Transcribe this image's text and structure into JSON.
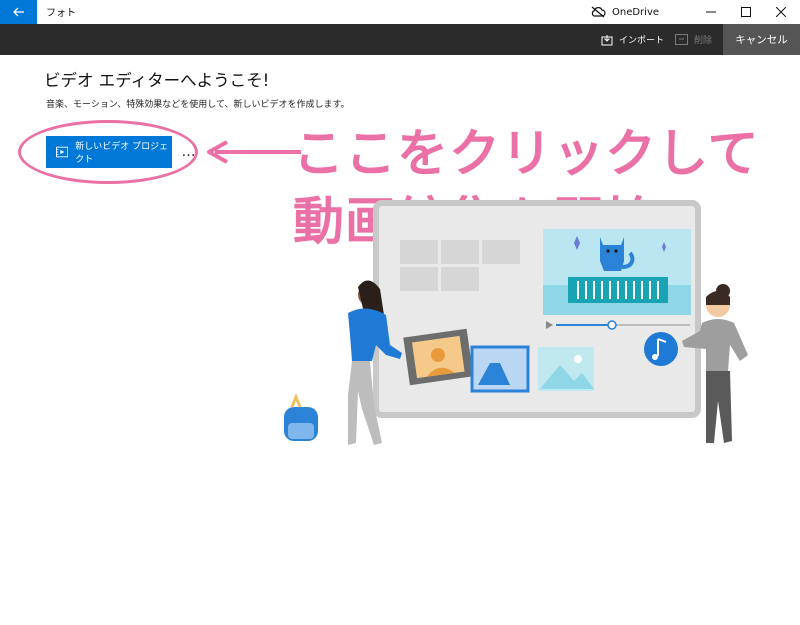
{
  "titlebar": {
    "app_title": "フォト",
    "onedrive_label": "OneDrive"
  },
  "toolbar": {
    "import_label": "インポート",
    "delete_label": "削除",
    "cancel_label": "キャンセル"
  },
  "main": {
    "heading": "ビデオ エディターへようこそ!",
    "subheading": "音楽、モーション、特殊効果などを使用して、新しいビデオを作成します。",
    "new_project_label": "新しいビデオ プロジェクト",
    "more_label": "…"
  },
  "annotation": {
    "line1": "ここをクリックして",
    "line2": "動画編集を開始",
    "color": "#ea70a5"
  },
  "colors": {
    "accent": "#0078d7",
    "toolbar_bg": "#2b2b2b",
    "cancel_bg": "#555555"
  }
}
